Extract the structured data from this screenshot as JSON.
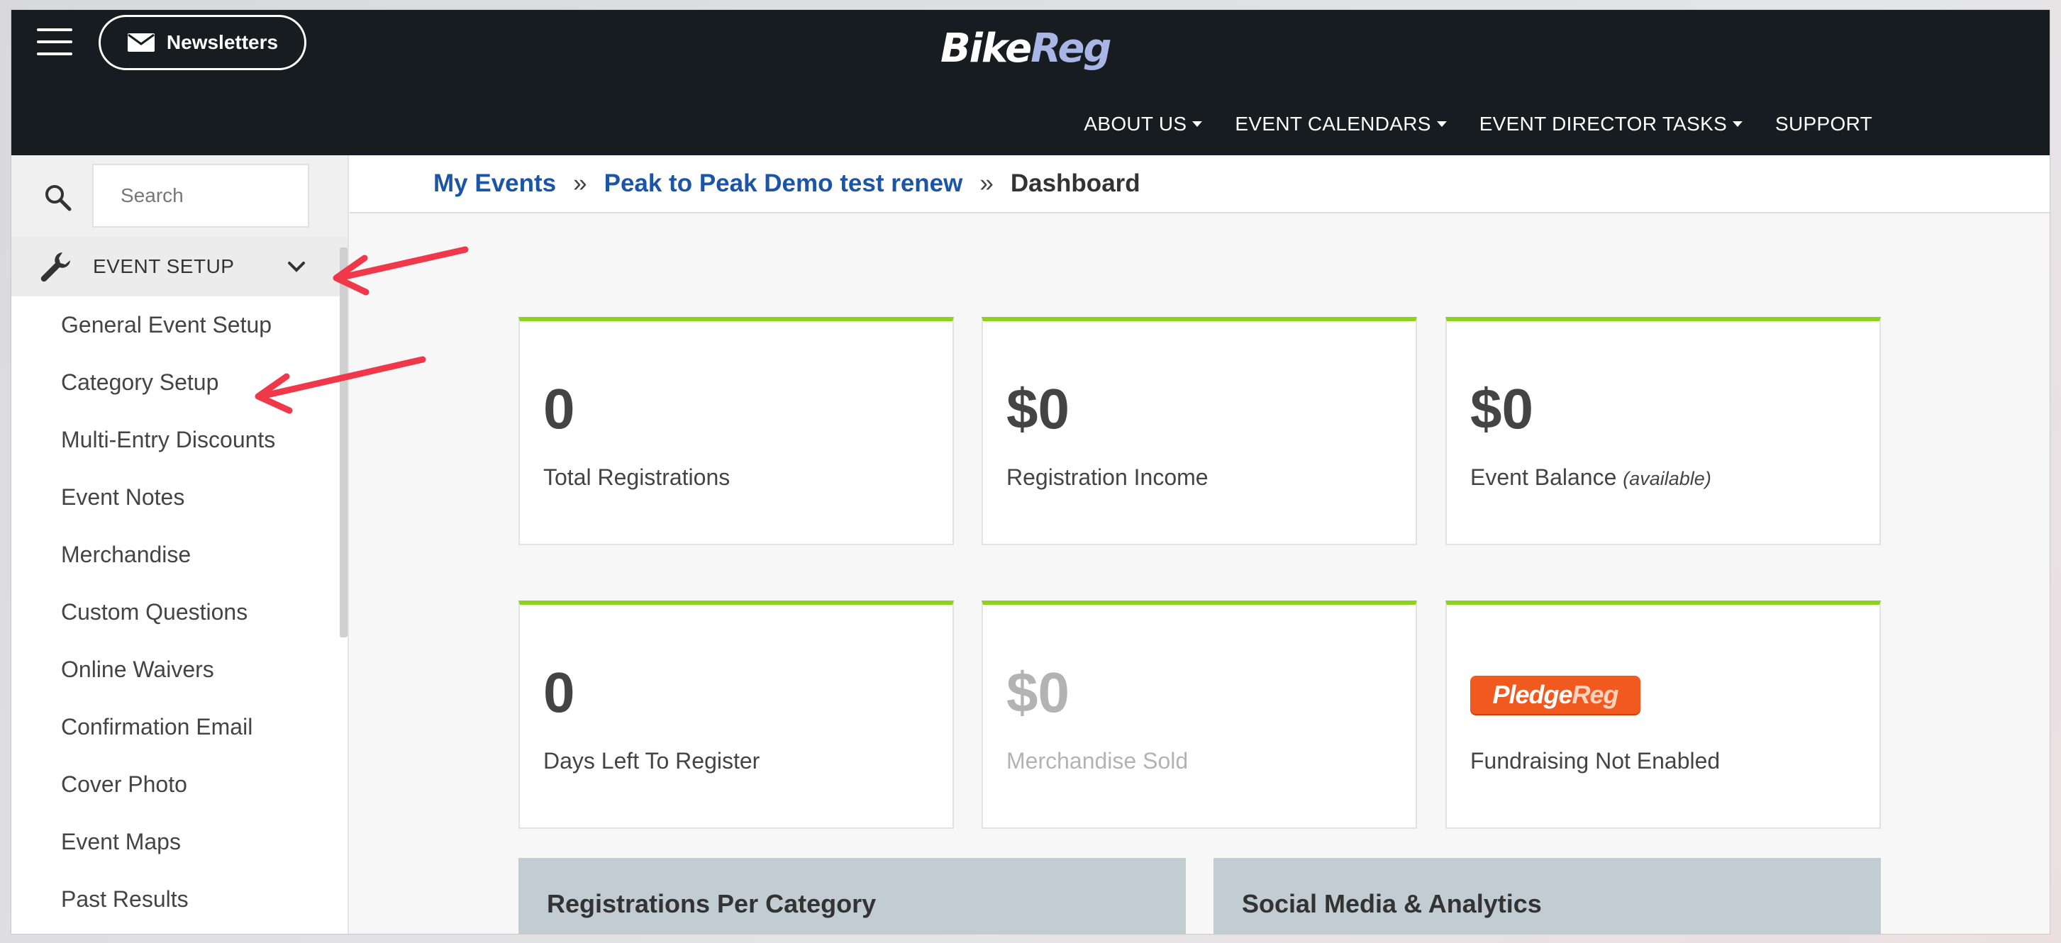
{
  "topbar": {
    "newsletters_label": "Newsletters",
    "logo_part1": "Bike",
    "logo_part2": "Reg",
    "nav": [
      {
        "label": "ABOUT US",
        "dropdown": true
      },
      {
        "label": "EVENT CALENDARS",
        "dropdown": true
      },
      {
        "label": "EVENT DIRECTOR TASKS",
        "dropdown": true
      },
      {
        "label": "SUPPORT",
        "dropdown": false
      }
    ]
  },
  "sidebar": {
    "search_placeholder": "Search",
    "section_label": "EVENT SETUP",
    "items": [
      "General Event Setup",
      "Category Setup",
      "Multi-Entry Discounts",
      "Event Notes",
      "Merchandise",
      "Custom Questions",
      "Online Waivers",
      "Confirmation Email",
      "Cover Photo",
      "Event Maps",
      "Past Results"
    ]
  },
  "breadcrumb": {
    "home": "My Events",
    "event": "Peak to Peak Demo test renew",
    "current": "Dashboard",
    "separator": "»"
  },
  "cards": {
    "total_registrations": {
      "value": "0",
      "label": "Total Registrations"
    },
    "registration_income": {
      "value": "$0",
      "label": "Registration Income"
    },
    "event_balance": {
      "value": "$0",
      "label": "Event Balance",
      "note": "(available)"
    },
    "days_left": {
      "value": "0",
      "label": "Days Left To Register"
    },
    "merchandise_sold": {
      "value": "$0",
      "label": "Merchandise Sold"
    },
    "fundraising": {
      "logo_part1": "Pledge",
      "logo_part2": "Reg",
      "label": "Fundraising Not Enabled"
    }
  },
  "panels": {
    "left_title": "Registrations Per Category",
    "right_title": "Social Media & Analytics"
  },
  "colors": {
    "topbar_bg": "#161c20",
    "card_accent": "#8fd11f",
    "link": "#1c55a6",
    "pledge_orange": "#f15a1f",
    "annotation_arrow": "#f0384b"
  }
}
